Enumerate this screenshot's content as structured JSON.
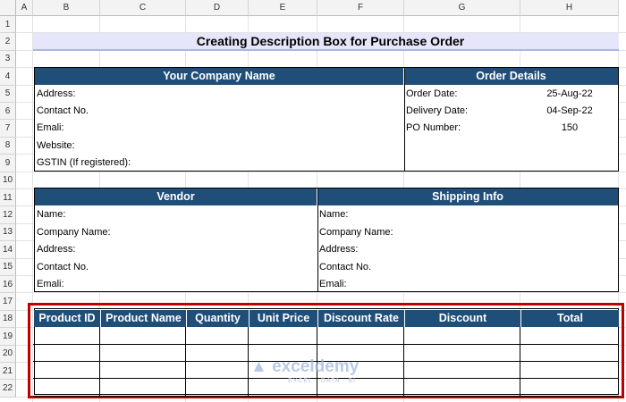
{
  "sheet": {
    "columns": [
      "A",
      "B",
      "C",
      "D",
      "E",
      "F",
      "G",
      "H"
    ],
    "rows": [
      "1",
      "2",
      "3",
      "4",
      "5",
      "6",
      "7",
      "8",
      "9",
      "10",
      "11",
      "12",
      "13",
      "14",
      "15",
      "16",
      "17",
      "18",
      "19",
      "20",
      "21",
      "22"
    ]
  },
  "title": "Creating Description Box for Purchase Order",
  "company": {
    "header": "Your Company Name",
    "fields": [
      "Address:",
      "Contact No.",
      "Emali:",
      "Website:",
      "GSTIN (If registered):"
    ]
  },
  "order": {
    "header": "Order Details",
    "fields": [
      {
        "label": "Order Date:",
        "value": "25-Aug-22"
      },
      {
        "label": "Delivery Date:",
        "value": "04-Sep-22"
      },
      {
        "label": "PO Number:",
        "value": "150"
      }
    ]
  },
  "vendor": {
    "header": "Vendor",
    "fields": [
      "Name:",
      "Company Name:",
      "Address:",
      "Contact No.",
      "Emali:"
    ]
  },
  "shipping": {
    "header": "Shipping Info",
    "fields": [
      "Name:",
      "Company Name:",
      "Address:",
      "Contact No.",
      "Emali:"
    ]
  },
  "products": {
    "headers": [
      "Product ID",
      "Product Name",
      "Quantity",
      "Unit Price",
      "Discount Rate",
      "Discount",
      "Total"
    ],
    "row_count": 4
  },
  "watermark": {
    "name": "exceldemy",
    "tagline": "EXCEL · DATA · BI"
  }
}
